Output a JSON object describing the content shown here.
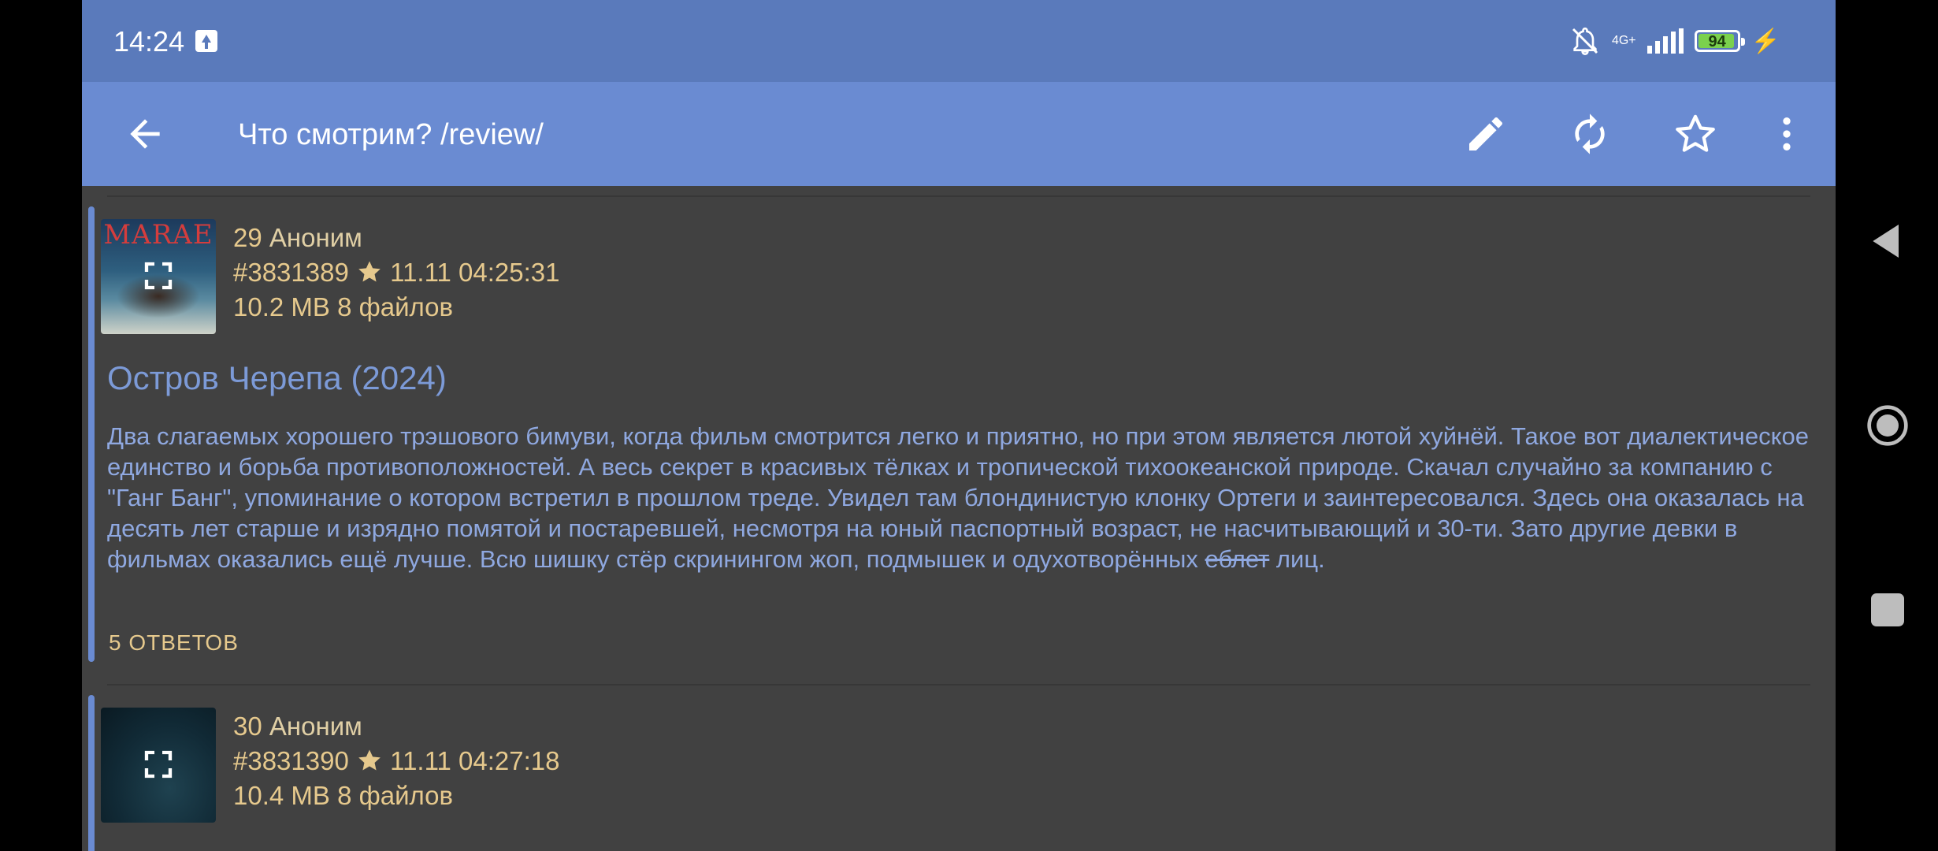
{
  "status_bar": {
    "time": "14:24",
    "network": "4G+",
    "battery": "94",
    "battery_fraction": 0.94
  },
  "app_bar": {
    "title": "Что смотрим? /review/",
    "back_icon": "arrow-left-icon",
    "actions": [
      "pencil-icon",
      "refresh-icon",
      "star-outline-icon",
      "more-vert-icon"
    ]
  },
  "posts": [
    {
      "number": "29",
      "author": "Аноним",
      "id": "#3831389",
      "date": "11.11 04:25:31",
      "files": "10.2 MB 8 файлов",
      "subject": "Остров Черепа (2024)",
      "body_main": "Два слагаемых хорошего трэшового бимуви, когда фильм смотрится легко и приятно, но при этом является лютой хуйнёй. Такое вот диалектическое единство и борьба противоположностей. А весь секрет в красивых тёлках и тропической тихоокеанской природе. Скачал случайно за компанию с \"Ганг Банг\", упоминание о котором встретил в прошлом треде. Увидел там блондинистую клонку Ортеги и заинтересовался. Здесь она оказалась на десять лет старше и изрядно помятой и постаревшей, несмотря на юный паспортный возраст, не насчитывающий и 30-ти. Зато другие девки в фильмах оказались ещё лучше. Всю шишку стёр скринингом жоп, подмышек и одухотворённых ",
      "body_strike": "еблет",
      "body_end": " лиц.",
      "replies": "5 ОТВЕТОВ",
      "thumb_caption": "MARAE"
    },
    {
      "number": "30",
      "author": "Аноним",
      "id": "#3831390",
      "date": "11.11 04:27:18",
      "files": "10.4 MB 8 файлов"
    }
  ],
  "nav_bar": {
    "icons": [
      "nav-back-icon",
      "nav-home-icon",
      "nav-recents-icon"
    ]
  }
}
